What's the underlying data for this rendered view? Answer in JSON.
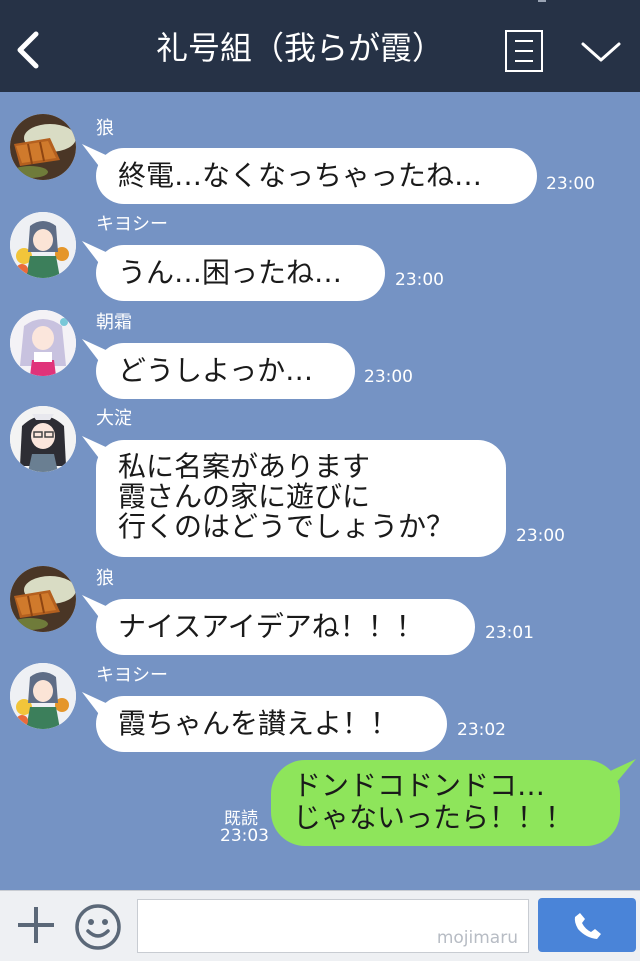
{
  "header": {
    "title": "礼号組（我らが霞）",
    "back_icon": "chevron-left-icon",
    "menu_icon": "notes-icon",
    "expand_icon": "chevron-down-icon",
    "bg_color": "#263246"
  },
  "chat": {
    "bg_color": "#7593c4",
    "messages": [
      {
        "sender": "狼",
        "avatar": "tonkatsu-avatar",
        "text": "終電…なくなっちゃったね…",
        "time": "23:00"
      },
      {
        "sender": "キヨシー",
        "avatar": "character-avatar",
        "text": "うん…困ったね…",
        "time": "23:00"
      },
      {
        "sender": "朝霜",
        "avatar": "character-avatar",
        "text": "どうしよっか…",
        "time": "23:00"
      },
      {
        "sender": "大淀",
        "avatar": "character-avatar",
        "text": "私に名案があります\n霞さんの家に遊びに\n行くのはどうでしょうか？",
        "time": "23:00"
      },
      {
        "sender": "狼",
        "avatar": "tonkatsu-avatar",
        "text": "ナイスアイデアね！！！",
        "time": "23:01"
      },
      {
        "sender": "キヨシー",
        "avatar": "character-avatar",
        "text": "霞ちゃんを讃えよ！！",
        "time": "23:02"
      }
    ],
    "my_message": {
      "text": "ドンドコドンドコ…\nじゃないったら！！！",
      "read_label": "既読",
      "time": "23:03",
      "bubble_color": "#8ee55b"
    }
  },
  "footer": {
    "plus_icon": "plus-icon",
    "emoji_icon": "smiley-icon",
    "input_value": "",
    "watermark": "mojimaru",
    "send_icon": "phone-icon",
    "send_color": "#4a84d8"
  }
}
